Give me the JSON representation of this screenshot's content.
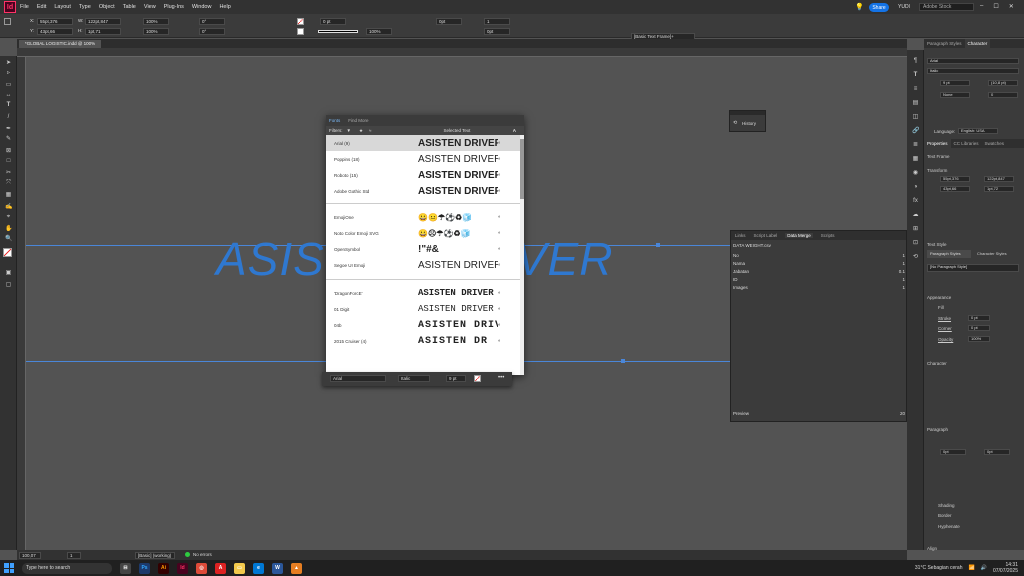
{
  "menubar": {
    "logo": "Id",
    "items": [
      "File",
      "Edit",
      "Layout",
      "Type",
      "Object",
      "Table",
      "View",
      "Plug-Ins",
      "Window",
      "Help"
    ],
    "share": "Share",
    "user": "YUDI",
    "search_placeholder": "Adobe Stock"
  },
  "control": {
    "x": "55pt,376",
    "y": "43pt,66",
    "w": "122pt,847",
    "h": "1pt,71",
    "scale_x": "100%",
    "scale_y": "100%",
    "rotate": "0°",
    "shear": "0°",
    "stroke_weight": "0 pt",
    "opacity": "100%",
    "gap_a": "0pt",
    "gap_b": "0pt",
    "cols": "1",
    "frame_style": "[Basic Text Frame]+"
  },
  "document": {
    "tab": "*GLOBAL LOGISTIC.indd @ 100%",
    "text": "ASISTEN DRIVER"
  },
  "fonts_panel": {
    "tabs": [
      "Fonts",
      "Find More"
    ],
    "filter_label": "Filters:",
    "selected_text": "Selected Text",
    "rows": [
      {
        "name": "Arial (9)",
        "sample": "ASISTEN DRIVER",
        "selected": true
      },
      {
        "name": "Poppins (18)",
        "sample": "ASISTEN DRIVER"
      },
      {
        "name": "Roboto (15)",
        "sample": "ASISTEN DRIVER"
      },
      {
        "name": "Adobe Gothic Std",
        "sample": "ASISTEN DRIVER"
      },
      {
        "name": "EmojiOne",
        "sample": "😀😐☂⚽♻🧊"
      },
      {
        "name": "Noto Color Emoji SVG",
        "sample": "😀☹☂⚽♻🧊"
      },
      {
        "name": "OpenSymbol",
        "sample": "!\"#&"
      },
      {
        "name": "Segoe UI Emoji",
        "sample": "ASISTEN DRIVER"
      },
      {
        "name": "'DragonForcE'",
        "sample": "ASISTEN DRIVER"
      },
      {
        "name": "01 Digit",
        "sample": "ASISTEN DRIVER"
      },
      {
        "name": "04b",
        "sample": "ASISTEN DRIVER"
      },
      {
        "name": "2015 Cruiser (4)",
        "sample": "ASISTEN DR"
      }
    ],
    "footer_font": "Arial",
    "footer_style": "Italic",
    "footer_size": "9 pt"
  },
  "history": {
    "title": "History"
  },
  "merge_panel": {
    "tabs": [
      "Links",
      "Script Label",
      "Data Merge",
      "Scripts"
    ],
    "source": "DATA WEIGHT.csv",
    "fields": [
      {
        "name": "No",
        "count": "1"
      },
      {
        "name": "Nama",
        "count": "1"
      },
      {
        "name": "Jabatan",
        "count": "0.1"
      },
      {
        "name": "ID",
        "count": "1"
      },
      {
        "name": "Images",
        "count": "1"
      }
    ],
    "preview": "Preview",
    "page": "20"
  },
  "right_panel": {
    "tabs": [
      "Paragraph Styles",
      "Character"
    ],
    "font": "Arial",
    "style": "Italic",
    "size": "9 pt",
    "leading": "(10,8 pt)",
    "kerning": "None",
    "tracking": "0",
    "language_label": "Language:",
    "language": "English: USA",
    "prop_tabs": [
      "Properties",
      "CC Libraries",
      "Swatches"
    ],
    "text_frame": "Text Frame",
    "transform": "Transform",
    "tx": "55pt,376",
    "ty": "43pt,66",
    "tw": "122pt,847",
    "th": "1pt,72",
    "text_style": "Text Style",
    "para_styles": "Paragraph Styles",
    "char_styles": "Character Styles",
    "no_style": "[No Paragraph Style]",
    "appearance": "Appearance",
    "fill": "Fill",
    "stroke": "Stroke",
    "stroke_val": "0 pt",
    "corner": "Corner",
    "corner_val": "0 pt",
    "opacity": "Opacity",
    "opacity_val": "100%",
    "character": "Character",
    "paragraph": "Paragraph",
    "para_val": "0pt",
    "hyphenate": "Hyphenate",
    "shading": "Shading",
    "border": "Border",
    "align": "Align"
  },
  "status": {
    "zoom": "100,07",
    "page": "1",
    "mode": "[Basic] (working)",
    "errors": "No errors"
  },
  "taskbar": {
    "search": "Type here to search",
    "weather": "31°C  Sebagian cerah",
    "time": "14:31",
    "date": "07/07/2025"
  }
}
